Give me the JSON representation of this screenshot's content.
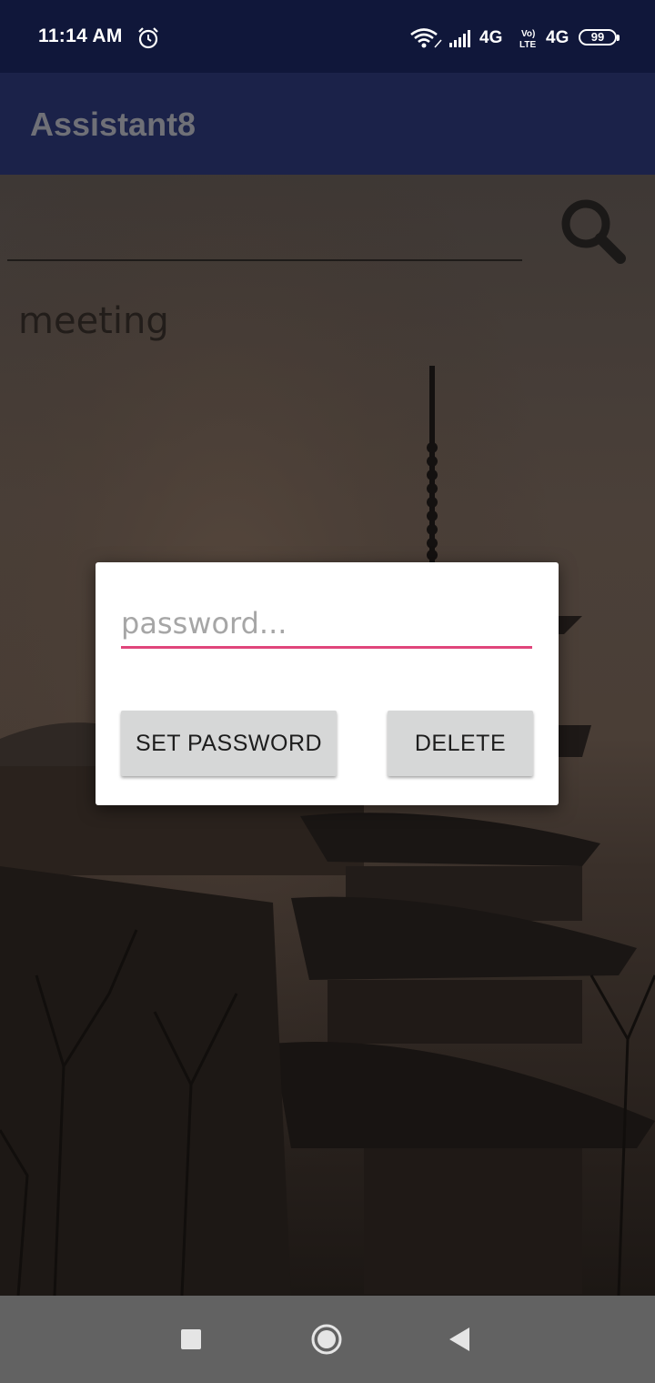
{
  "status_bar": {
    "time": "11:14 AM",
    "network_1": "4G",
    "network_2": "4G",
    "battery": "99",
    "icons": [
      "alarm-icon",
      "wifi-icon",
      "signal-icon",
      "volte-icon",
      "battery-icon"
    ]
  },
  "app_bar": {
    "title": "Assistant8"
  },
  "search": {
    "placeholder": "",
    "icon": "search-icon"
  },
  "notes": {
    "items": [
      "meeting"
    ]
  },
  "dialog": {
    "password_placeholder": "password...",
    "set_password_label": "SET PASSWORD",
    "delete_label": "DELETE",
    "accent_color": "#e0457b"
  },
  "nav_bar": {
    "icons": [
      "recent-apps-icon",
      "home-icon",
      "back-icon"
    ]
  }
}
